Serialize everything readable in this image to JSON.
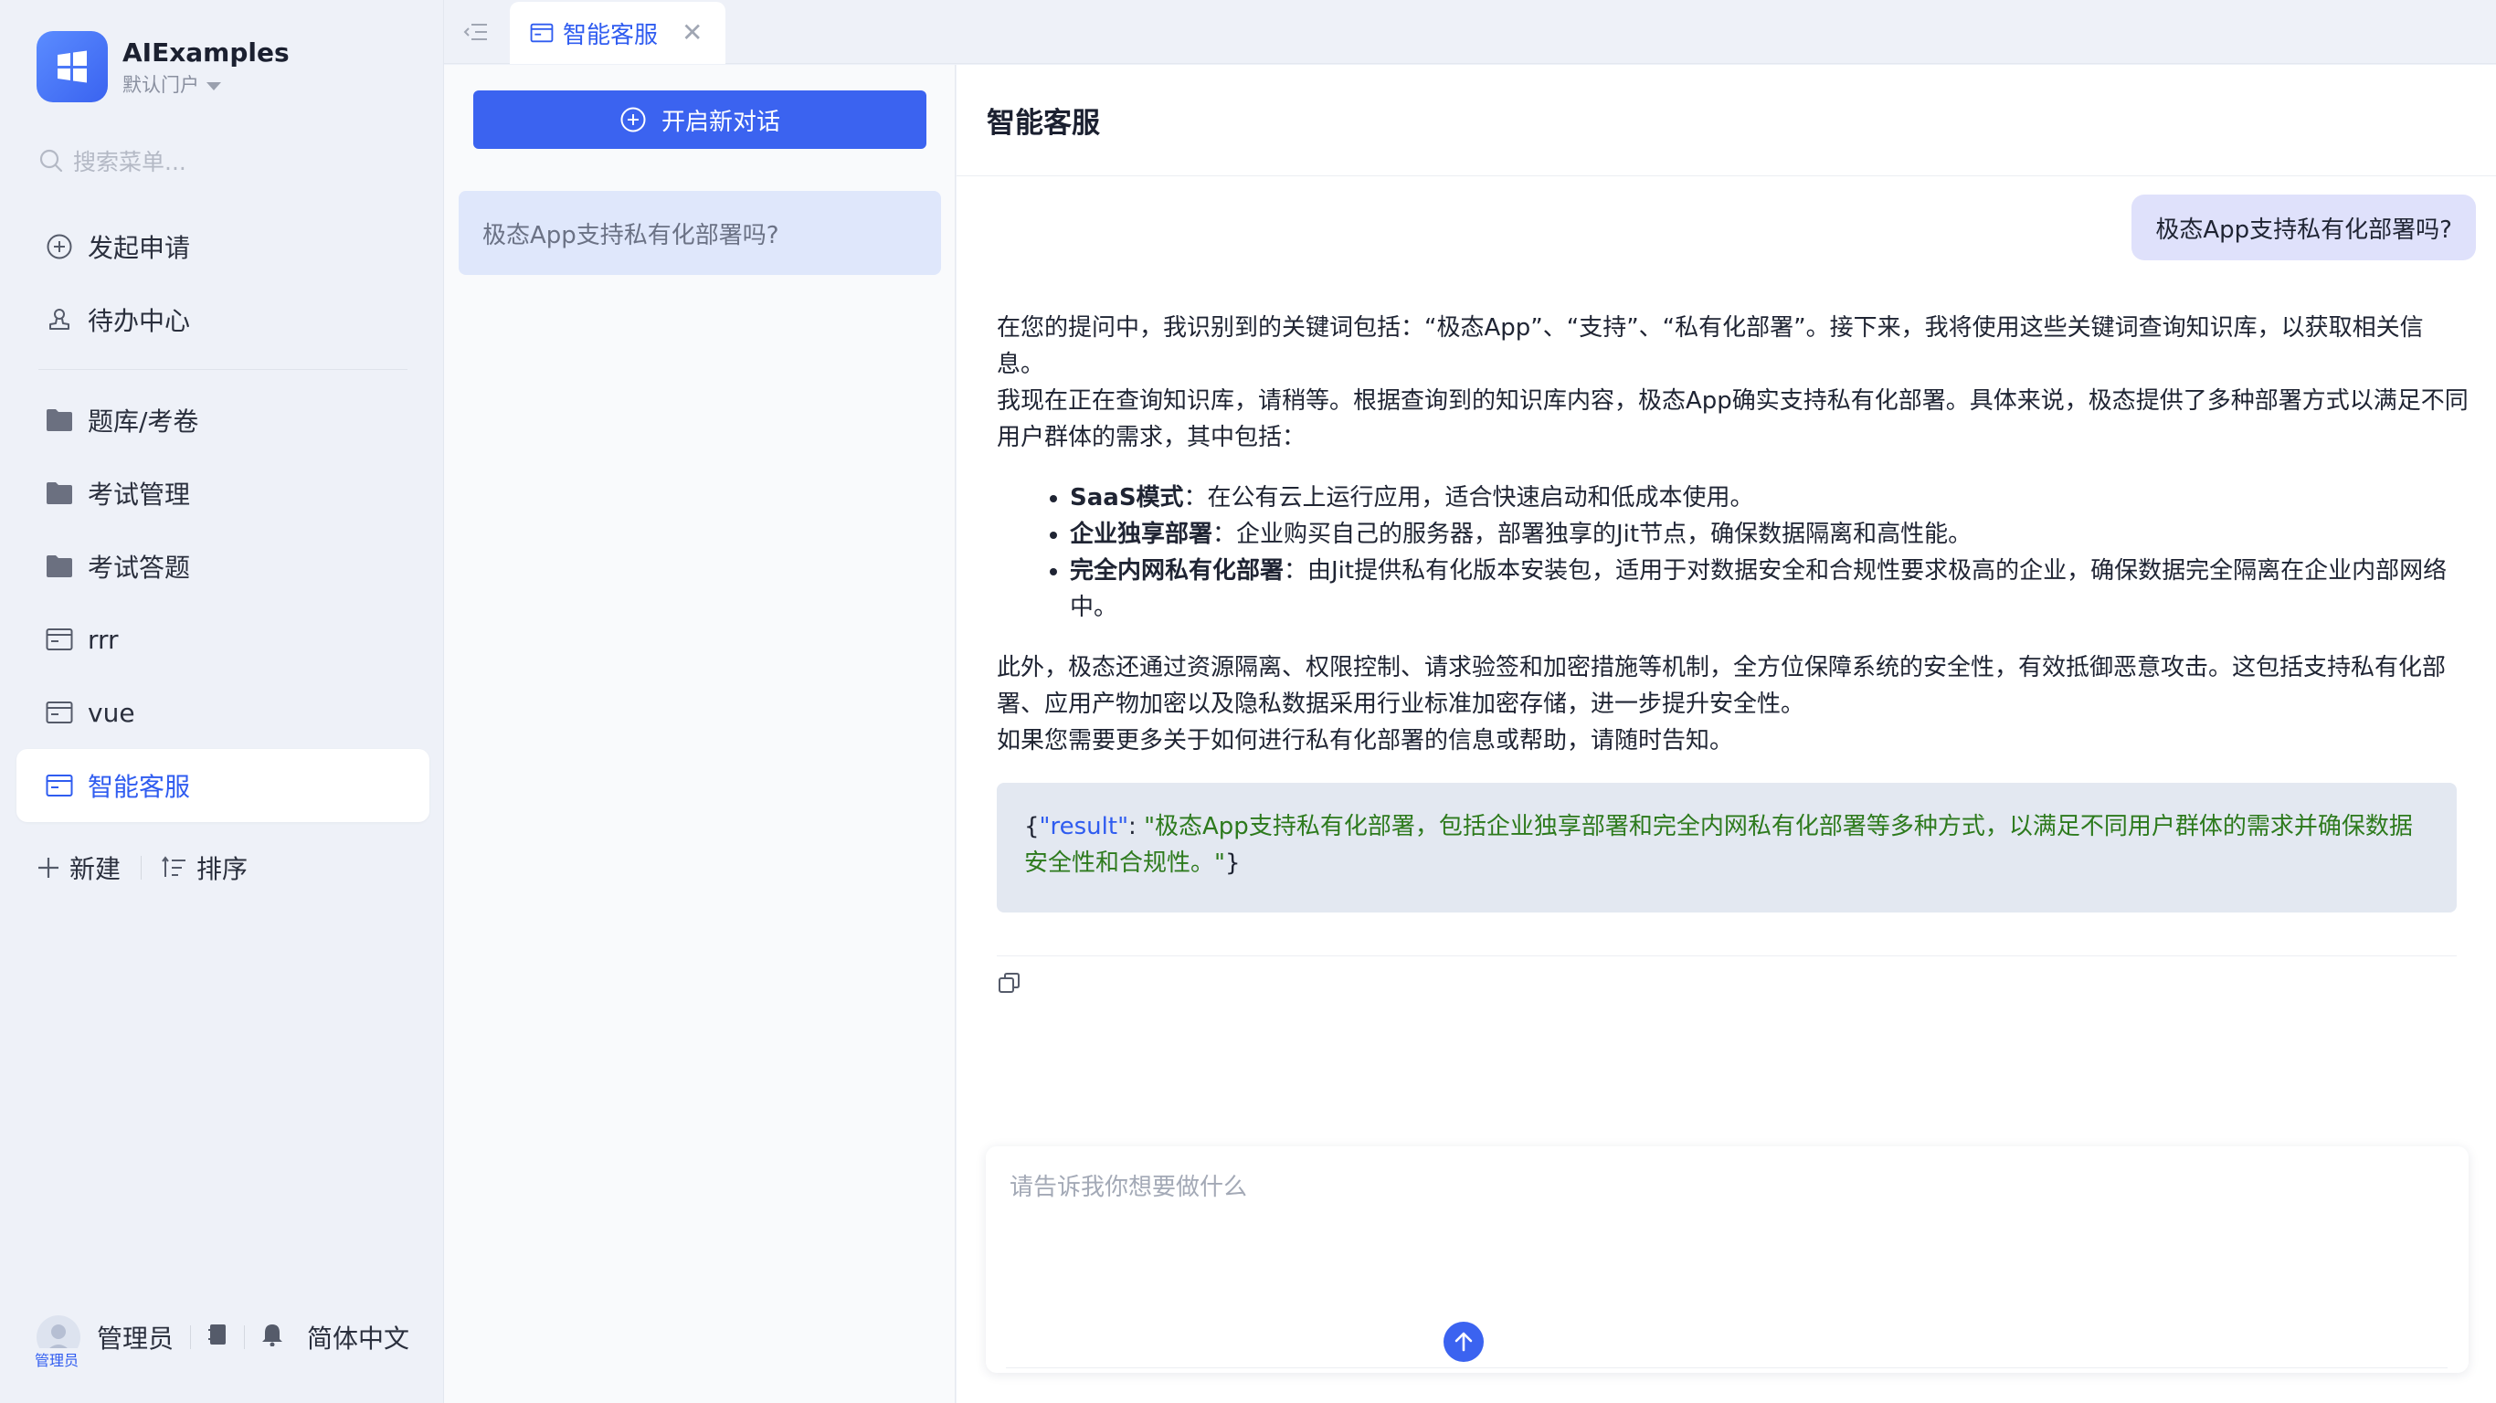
{
  "brand": {
    "name": "AIExamples",
    "portal": "默认门户"
  },
  "sidebar": {
    "search_placeholder": "搜索菜单...",
    "items": [
      {
        "label": "发起申请",
        "icon": "plus-circle-icon"
      },
      {
        "label": "待办中心",
        "icon": "stamp-icon"
      },
      {
        "label": "题库/考卷",
        "icon": "folder-icon"
      },
      {
        "label": "考试管理",
        "icon": "folder-icon"
      },
      {
        "label": "考试答题",
        "icon": "folder-icon"
      },
      {
        "label": "rrr",
        "icon": "window-icon"
      },
      {
        "label": "vue",
        "icon": "window-icon"
      },
      {
        "label": "智能客服",
        "icon": "window-icon",
        "active": true
      }
    ],
    "new_label": "新建",
    "sort_label": "排序",
    "footer": {
      "user": "管理员",
      "avatar_tag": "管理员",
      "language": "简体中文"
    }
  },
  "tabs": [
    {
      "label": "智能客服",
      "active": true
    }
  ],
  "conversations": {
    "new_chat_label": "开启新对话",
    "items": [
      {
        "title": "极态App支持私有化部署吗?"
      }
    ]
  },
  "chat": {
    "title": "智能客服",
    "user_message": "极态App支持私有化部署吗?",
    "answer": {
      "p1": "在您的提问中，我识别到的关键词包括：“极态App”、“支持”、“私有化部署”。接下来，我将使用这些关键词查询知识库，以获取相关信息。",
      "p2": "我现在正在查询知识库，请稍等。根据查询到的知识库内容，极态App确实支持私有化部署。具体来说，极态提供了多种部署方式以满足不同用户群体的需求，其中包括：",
      "bullets": [
        {
          "term": "SaaS模式",
          "desc": "：在公有云上运行应用，适合快速启动和低成本使用。"
        },
        {
          "term": "企业独享部署",
          "desc": "：企业购买自己的服务器，部署独享的Jit节点，确保数据隔离和高性能。"
        },
        {
          "term": "完全内网私有化部署",
          "desc": "：由Jit提供私有化版本安装包，适用于对数据安全和合规性要求极高的企业，确保数据完全隔离在企业内部网络中。"
        }
      ],
      "p3": "此外，极态还通过资源隔离、权限控制、请求验签和加密措施等机制，全方位保障系统的安全性，有效抵御恶意攻击。这包括支持私有化部署、应用产物加密以及隐私数据采用行业标准加密存储，进一步提升安全性。",
      "p4": "如果您需要更多关于如何进行私有化部署的信息或帮助，请随时告知。"
    },
    "result": {
      "open": "{",
      "key": "\"result\"",
      "colon": ": ",
      "value": "\"极态App支持私有化部署，包括企业独享部署和完全内网私有化部署等多种方式，以满足不同用户群体的需求并确保数据安全性和合规性。\"",
      "close": "}"
    },
    "input_placeholder": "请告诉我你想要做什么"
  },
  "colors": {
    "accent": "#3b63f0",
    "active_bg": "#ffffff",
    "result_text": "#2d7a1d"
  }
}
